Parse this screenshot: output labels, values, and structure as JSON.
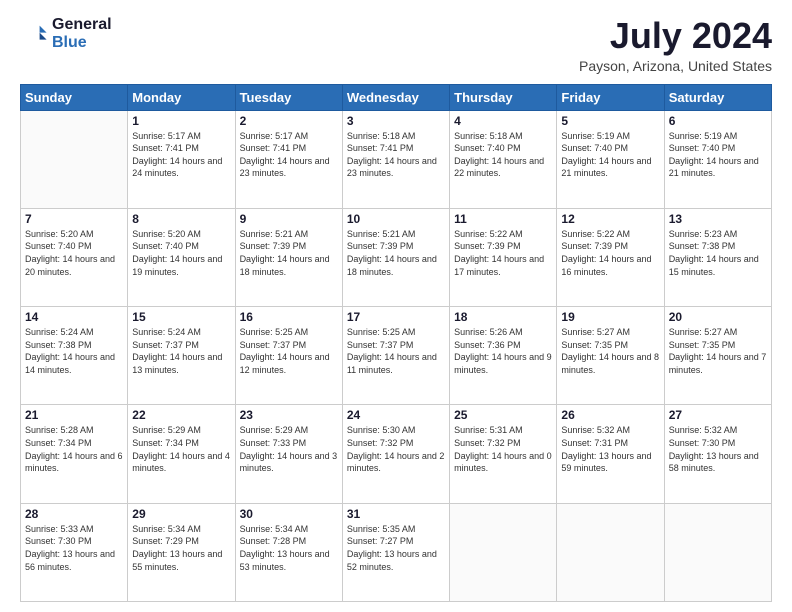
{
  "header": {
    "logo_line1": "General",
    "logo_line2": "Blue",
    "main_title": "July 2024",
    "subtitle": "Payson, Arizona, United States"
  },
  "calendar": {
    "weekdays": [
      "Sunday",
      "Monday",
      "Tuesday",
      "Wednesday",
      "Thursday",
      "Friday",
      "Saturday"
    ],
    "weeks": [
      [
        {
          "day": "",
          "info": ""
        },
        {
          "day": "1",
          "info": "Sunrise: 5:17 AM\nSunset: 7:41 PM\nDaylight: 14 hours\nand 24 minutes."
        },
        {
          "day": "2",
          "info": "Sunrise: 5:17 AM\nSunset: 7:41 PM\nDaylight: 14 hours\nand 23 minutes."
        },
        {
          "day": "3",
          "info": "Sunrise: 5:18 AM\nSunset: 7:41 PM\nDaylight: 14 hours\nand 23 minutes."
        },
        {
          "day": "4",
          "info": "Sunrise: 5:18 AM\nSunset: 7:40 PM\nDaylight: 14 hours\nand 22 minutes."
        },
        {
          "day": "5",
          "info": "Sunrise: 5:19 AM\nSunset: 7:40 PM\nDaylight: 14 hours\nand 21 minutes."
        },
        {
          "day": "6",
          "info": "Sunrise: 5:19 AM\nSunset: 7:40 PM\nDaylight: 14 hours\nand 21 minutes."
        }
      ],
      [
        {
          "day": "7",
          "info": "Sunrise: 5:20 AM\nSunset: 7:40 PM\nDaylight: 14 hours\nand 20 minutes."
        },
        {
          "day": "8",
          "info": "Sunrise: 5:20 AM\nSunset: 7:40 PM\nDaylight: 14 hours\nand 19 minutes."
        },
        {
          "day": "9",
          "info": "Sunrise: 5:21 AM\nSunset: 7:39 PM\nDaylight: 14 hours\nand 18 minutes."
        },
        {
          "day": "10",
          "info": "Sunrise: 5:21 AM\nSunset: 7:39 PM\nDaylight: 14 hours\nand 18 minutes."
        },
        {
          "day": "11",
          "info": "Sunrise: 5:22 AM\nSunset: 7:39 PM\nDaylight: 14 hours\nand 17 minutes."
        },
        {
          "day": "12",
          "info": "Sunrise: 5:22 AM\nSunset: 7:39 PM\nDaylight: 14 hours\nand 16 minutes."
        },
        {
          "day": "13",
          "info": "Sunrise: 5:23 AM\nSunset: 7:38 PM\nDaylight: 14 hours\nand 15 minutes."
        }
      ],
      [
        {
          "day": "14",
          "info": "Sunrise: 5:24 AM\nSunset: 7:38 PM\nDaylight: 14 hours\nand 14 minutes."
        },
        {
          "day": "15",
          "info": "Sunrise: 5:24 AM\nSunset: 7:37 PM\nDaylight: 14 hours\nand 13 minutes."
        },
        {
          "day": "16",
          "info": "Sunrise: 5:25 AM\nSunset: 7:37 PM\nDaylight: 14 hours\nand 12 minutes."
        },
        {
          "day": "17",
          "info": "Sunrise: 5:25 AM\nSunset: 7:37 PM\nDaylight: 14 hours\nand 11 minutes."
        },
        {
          "day": "18",
          "info": "Sunrise: 5:26 AM\nSunset: 7:36 PM\nDaylight: 14 hours\nand 9 minutes."
        },
        {
          "day": "19",
          "info": "Sunrise: 5:27 AM\nSunset: 7:35 PM\nDaylight: 14 hours\nand 8 minutes."
        },
        {
          "day": "20",
          "info": "Sunrise: 5:27 AM\nSunset: 7:35 PM\nDaylight: 14 hours\nand 7 minutes."
        }
      ],
      [
        {
          "day": "21",
          "info": "Sunrise: 5:28 AM\nSunset: 7:34 PM\nDaylight: 14 hours\nand 6 minutes."
        },
        {
          "day": "22",
          "info": "Sunrise: 5:29 AM\nSunset: 7:34 PM\nDaylight: 14 hours\nand 4 minutes."
        },
        {
          "day": "23",
          "info": "Sunrise: 5:29 AM\nSunset: 7:33 PM\nDaylight: 14 hours\nand 3 minutes."
        },
        {
          "day": "24",
          "info": "Sunrise: 5:30 AM\nSunset: 7:32 PM\nDaylight: 14 hours\nand 2 minutes."
        },
        {
          "day": "25",
          "info": "Sunrise: 5:31 AM\nSunset: 7:32 PM\nDaylight: 14 hours\nand 0 minutes."
        },
        {
          "day": "26",
          "info": "Sunrise: 5:32 AM\nSunset: 7:31 PM\nDaylight: 13 hours\nand 59 minutes."
        },
        {
          "day": "27",
          "info": "Sunrise: 5:32 AM\nSunset: 7:30 PM\nDaylight: 13 hours\nand 58 minutes."
        }
      ],
      [
        {
          "day": "28",
          "info": "Sunrise: 5:33 AM\nSunset: 7:30 PM\nDaylight: 13 hours\nand 56 minutes."
        },
        {
          "day": "29",
          "info": "Sunrise: 5:34 AM\nSunset: 7:29 PM\nDaylight: 13 hours\nand 55 minutes."
        },
        {
          "day": "30",
          "info": "Sunrise: 5:34 AM\nSunset: 7:28 PM\nDaylight: 13 hours\nand 53 minutes."
        },
        {
          "day": "31",
          "info": "Sunrise: 5:35 AM\nSunset: 7:27 PM\nDaylight: 13 hours\nand 52 minutes."
        },
        {
          "day": "",
          "info": ""
        },
        {
          "day": "",
          "info": ""
        },
        {
          "day": "",
          "info": ""
        }
      ]
    ]
  }
}
